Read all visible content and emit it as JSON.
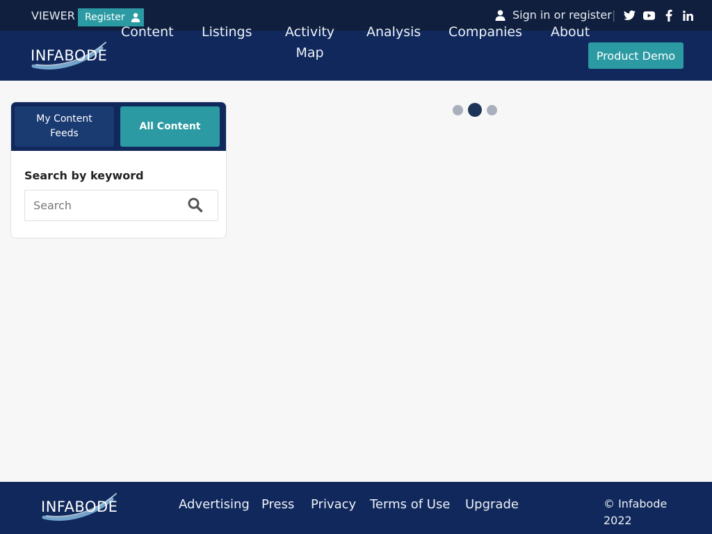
{
  "topbar": {
    "viewer_label": "VIEWER",
    "register_label": "Register",
    "register_icon": "user-icon",
    "signin_label": "Sign in or register",
    "signin_icon": "user-icon",
    "separator": "|",
    "social_icons": [
      "twitter-icon",
      "youtube-icon",
      "facebook-icon",
      "linkedin-icon"
    ]
  },
  "brand": {
    "logo_text": "INFABODE"
  },
  "nav": {
    "items": [
      {
        "line1": "Content",
        "line2": ""
      },
      {
        "line1": "Listings",
        "line2": ""
      },
      {
        "line1": "Activity",
        "line2": "Map"
      },
      {
        "line1": "Analysis",
        "line2": ""
      },
      {
        "line1": "Companies",
        "line2": ""
      },
      {
        "line1": "About",
        "line2": ""
      }
    ],
    "demo_label": "Product Demo"
  },
  "sidebar": {
    "tabs": [
      {
        "line1": "My Content",
        "line2": "Feeds",
        "active": false
      },
      {
        "line1": "All Content",
        "line2": "",
        "active": true
      }
    ],
    "search_label": "Search by keyword",
    "search_placeholder": "Search",
    "search_icon": "search-icon"
  },
  "loader": {
    "dots": 3,
    "active_dot": 2
  },
  "footer": {
    "links": [
      "Advertising",
      "Press",
      "Privacy",
      "Terms of Use",
      "Upgrade"
    ],
    "copyright_line1": "© Infabode",
    "copyright_line2": "2022"
  },
  "colors": {
    "topbar_bg": "#0f1f3d",
    "nav_bg": "#10285b",
    "accent_teal": "#2b9aa3",
    "tab_inactive": "#1a3a72",
    "loader_active": "#1e3358",
    "loader_idle": "#a9b0bd",
    "page_bg": "#f7f7f7"
  }
}
